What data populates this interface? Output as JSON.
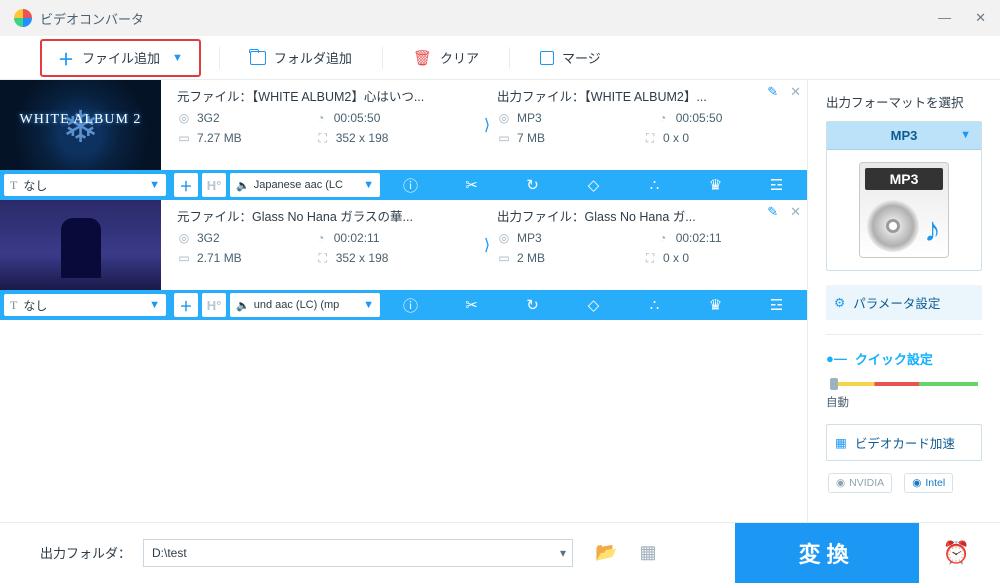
{
  "app": {
    "title": "ビデオコンバータ"
  },
  "toolbar": {
    "add_file": "ファイル追加",
    "add_folder": "フォルダ追加",
    "clear": "クリア",
    "merge": "マージ"
  },
  "items": [
    {
      "source": {
        "label": "元ファイル：",
        "name": "【WHITE ALBUM2】心はいつ...",
        "container": "3G2",
        "duration": "00:05:50",
        "size": "7.27 MB",
        "dimensions": "352 x 198"
      },
      "output": {
        "label": "出力ファイル：",
        "name": "【WHITE ALBUM2】...",
        "container": "MP3",
        "duration": "00:05:50",
        "size": "7 MB",
        "dimensions": "0 x 0"
      },
      "subtitle": "なし",
      "audio": "Japanese aac (LC"
    },
    {
      "source": {
        "label": "元ファイル：",
        "name": "Glass No Hana ガラスの華...",
        "container": "3G2",
        "duration": "00:02:11",
        "size": "2.71 MB",
        "dimensions": "352 x 198"
      },
      "output": {
        "label": "出力ファイル：",
        "name": "Glass No Hana ガ...",
        "container": "MP3",
        "duration": "00:02:11",
        "size": "2 MB",
        "dimensions": "0 x 0"
      },
      "subtitle": "なし",
      "audio": "und aac (LC) (mp"
    }
  ],
  "side": {
    "header": "出力フォーマットを選択",
    "format": "MP3",
    "format_icon_label": "MP3",
    "param_btn": "パラメータ設定",
    "quick_hdr": "クイック設定",
    "slider_mode": "自動",
    "gpu_btn": "ビデオカード加速",
    "gpu_nvidia": "NVIDIA",
    "gpu_intel": "Intel"
  },
  "footer": {
    "out_folder_label": "出力フォルダ：",
    "out_folder_path": "D:\\test",
    "convert": "変換"
  },
  "icons": {
    "play": "▶",
    "plus": "＋",
    "folder": "📁",
    "trash": "🗑",
    "pen": "✎",
    "close": "✕",
    "info": "ⓘ",
    "cut": "✂",
    "rotate": "↻",
    "crop": "▢",
    "fx": "✨",
    "wm": "♔",
    "sub": "☲",
    "strip_h": "H°",
    "clock": "⏲"
  }
}
